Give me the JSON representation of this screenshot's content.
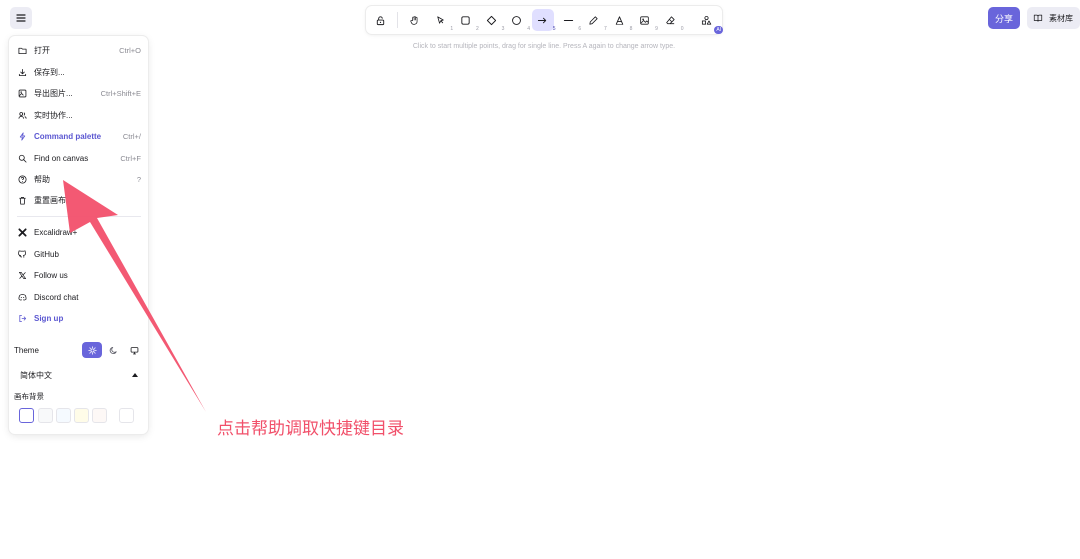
{
  "colors": {
    "accent": "#6965db",
    "accent_light": "#e0dfff",
    "annotation": "#f1506a"
  },
  "toolbar": {
    "tools": [
      {
        "name": "lock",
        "icon": "lock-icon",
        "key": ""
      },
      {
        "name": "hand",
        "icon": "hand-icon",
        "key": ""
      },
      {
        "name": "selection",
        "icon": "pointer-icon",
        "key": "1"
      },
      {
        "name": "rectangle",
        "icon": "square-icon",
        "key": "2"
      },
      {
        "name": "diamond",
        "icon": "diamond-icon",
        "key": "3"
      },
      {
        "name": "ellipse",
        "icon": "circle-icon",
        "key": "4"
      },
      {
        "name": "arrow",
        "icon": "arrow-right-icon",
        "key": "5",
        "active": true
      },
      {
        "name": "line",
        "icon": "line-icon",
        "key": "6"
      },
      {
        "name": "draw",
        "icon": "pencil-icon",
        "key": "7"
      },
      {
        "name": "text",
        "icon": "text-icon",
        "key": "8"
      },
      {
        "name": "image",
        "icon": "image-icon",
        "key": "9"
      },
      {
        "name": "eraser",
        "icon": "eraser-icon",
        "key": "0"
      },
      {
        "name": "more-shapes",
        "icon": "shapes-icon",
        "badge": "AI"
      }
    ]
  },
  "hint": "Click to start multiple points, drag for single line. Press A again to change arrow type.",
  "share_label": "分享",
  "library_label": "素材库",
  "menu": {
    "items": [
      {
        "icon": "folder-icon",
        "label": "打开",
        "shortcut": "Ctrl+O"
      },
      {
        "icon": "download-icon",
        "label": "保存到...",
        "shortcut": ""
      },
      {
        "icon": "export-image-icon",
        "label": "导出图片...",
        "shortcut": "Ctrl+Shift+E"
      },
      {
        "icon": "users-icon",
        "label": "实时协作...",
        "shortcut": ""
      },
      {
        "icon": "bolt-icon",
        "label": "Command palette",
        "shortcut": "Ctrl+/"
      },
      {
        "icon": "search-icon",
        "label": "Find on canvas",
        "shortcut": "Ctrl+F"
      },
      {
        "icon": "help-icon",
        "label": "帮助",
        "shortcut": "?"
      },
      {
        "icon": "trash-icon",
        "label": "重置画布",
        "shortcut": ""
      }
    ],
    "links": [
      {
        "icon": "excalidraw-plus-icon",
        "label": "Excalidraw+"
      },
      {
        "icon": "github-icon",
        "label": "GitHub"
      },
      {
        "icon": "x-logo-icon",
        "label": "Follow us"
      },
      {
        "icon": "discord-icon",
        "label": "Discord chat"
      },
      {
        "icon": "sign-up-icon",
        "label": "Sign up"
      }
    ],
    "theme_label": "Theme",
    "theme_selected": "light",
    "language": "简体中文",
    "background_label": "画布背景",
    "background_colors": [
      "#ffffff",
      "#f8f9fa",
      "#f5faff",
      "#fffce8",
      "#fdf8f6",
      "#ffffff"
    ]
  },
  "annotation_text": "点击帮助调取快捷键目录"
}
